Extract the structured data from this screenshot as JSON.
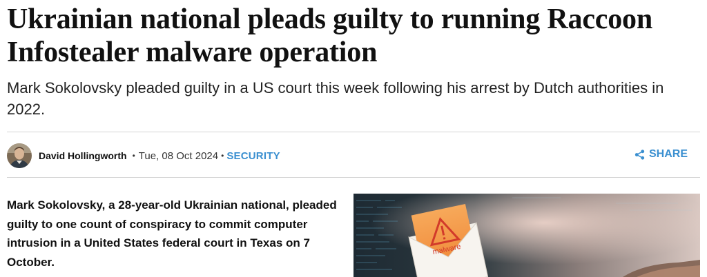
{
  "article": {
    "headline": "Ukrainian national pleads guilty to running Raccoon Infostealer malware operation",
    "subheadline": "Mark Sokolovsky pleaded guilty in a US court this week following his arrest by Dutch authorities in 2022.",
    "author": "David Hollingworth",
    "separator": "•",
    "date": "Tue, 08 Oct 2024",
    "category": "SECURITY",
    "share_label": "SHARE",
    "lede": "Mark Sokolovsky, a 28-year-old Ukrainian national, pleaded guilty to one count of conspiracy to commit computer intrusion in a United States federal court in Texas on 7 October.",
    "hero_image_label": "malware"
  },
  "colors": {
    "accent": "#3a8fd0",
    "rule": "#d4d4d4",
    "headline": "#111111"
  },
  "icons": {
    "share": "share-icon",
    "avatar": "author-avatar",
    "warning": "warning-triangle-icon"
  }
}
